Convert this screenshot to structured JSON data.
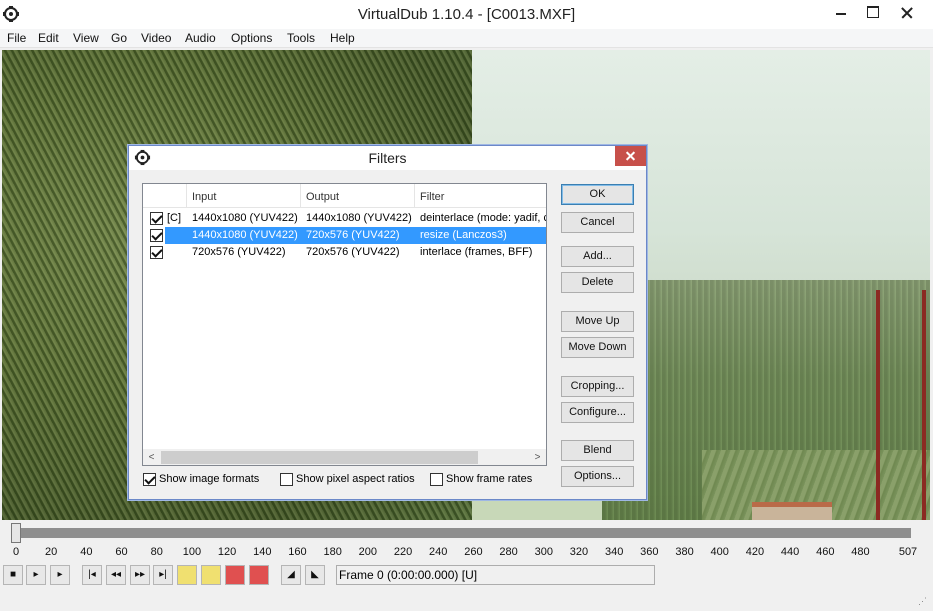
{
  "window": {
    "title": "VirtualDub 1.10.4 - [C0013.MXF]",
    "icon": "virtualdub-icon"
  },
  "menu": [
    "File",
    "Edit",
    "View",
    "Go",
    "Video",
    "Audio",
    "Options",
    "Tools",
    "Help"
  ],
  "dialog": {
    "title": "Filters",
    "columns": [
      "Input",
      "Output",
      "Filter"
    ],
    "rows": [
      {
        "checked": true,
        "flag": "[C]",
        "input": "1440x1080 (YUV422)",
        "output": "1440x1080 (YUV422)",
        "filter": "deinterlace (mode: yadif, c",
        "selected": false
      },
      {
        "checked": true,
        "flag": "",
        "input": "1440x1080 (YUV422)",
        "output": "720x576 (YUV422)",
        "filter": "resize (Lanczos3)",
        "selected": true
      },
      {
        "checked": true,
        "flag": "",
        "input": "720x576 (YUV422)",
        "output": "720x576 (YUV422)",
        "filter": "interlace (frames, BFF)",
        "selected": false
      }
    ],
    "buttons": {
      "ok": "OK",
      "cancel": "Cancel",
      "add": "Add...",
      "delete": "Delete",
      "move_up": "Move Up",
      "move_down": "Move Down",
      "cropping": "Cropping...",
      "configure": "Configure...",
      "blend": "Blend",
      "options": "Options..."
    },
    "checkboxes": {
      "image_formats": {
        "label": "Show image formats",
        "checked": true
      },
      "pixel_aspect": {
        "label": "Show pixel aspect ratios",
        "checked": false
      },
      "frame_rates": {
        "label": "Show frame rates",
        "checked": false
      }
    },
    "scroll_left": "<",
    "scroll_right": ">"
  },
  "timeline": {
    "ticks": [
      "0",
      "20",
      "40",
      "60",
      "80",
      "100",
      "120",
      "140",
      "160",
      "180",
      "200",
      "220",
      "240",
      "260",
      "280",
      "300",
      "320",
      "340",
      "360",
      "380",
      "400",
      "420",
      "440",
      "460",
      "480",
      "507"
    ],
    "position": 0
  },
  "toolbar": {
    "buttons": [
      "stop-icon",
      "play-input-icon",
      "play-output-icon",
      "start-icon",
      "prev-frame-icon",
      "next-frame-icon",
      "end-icon",
      "prev-key-icon",
      "next-key-icon",
      "scene-back-icon",
      "scene-fwd-icon",
      "mark-in-icon",
      "mark-out-icon"
    ],
    "status": "Frame 0 (0:00:00.000) [U]"
  }
}
